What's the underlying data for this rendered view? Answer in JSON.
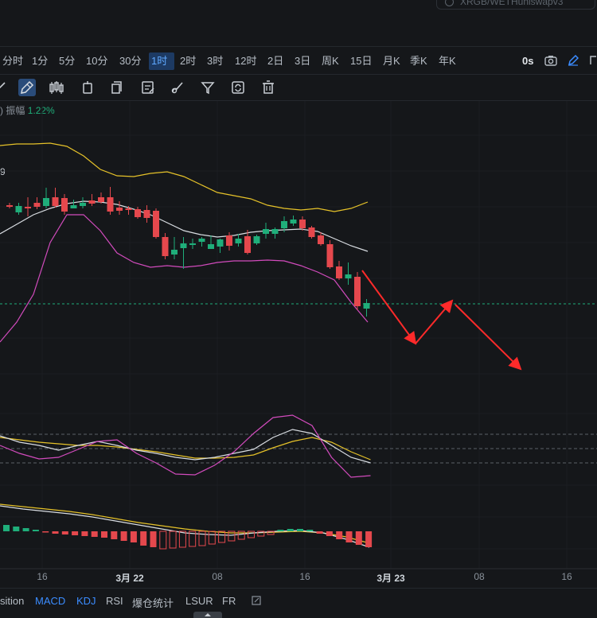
{
  "search": {
    "placeholder": "XRGB/WETHuniswapv3"
  },
  "timeframes": [
    "分时",
    "1分",
    "5分",
    "10分",
    "30分",
    "1时",
    "2时",
    "3时",
    "12时",
    "2日",
    "3日",
    "周K",
    "15日",
    "月K",
    "季K",
    "年K"
  ],
  "active_timeframe": "1时",
  "countdown": "0s",
  "tools": [
    "cursor-icon",
    "pencil-line-icon",
    "candlestick-icon",
    "indicator-icon",
    "copy-icon",
    "note-icon",
    "brush-icon",
    "filter-icon",
    "sync-icon",
    "trash-icon"
  ],
  "legend": {
    "prefix": ")",
    "label": "振幅",
    "value": "1.22%"
  },
  "ma_value": "9",
  "x_axis_labels": [
    "16",
    "3月 22",
    "08",
    "16",
    "3月 23",
    "08",
    "16"
  ],
  "indicator_tabs": [
    "sition",
    "MACD",
    "KDJ",
    "RSI",
    "爆仓统计",
    "LSUR",
    "FR"
  ],
  "active_indicators": [
    "MACD",
    "KDJ"
  ],
  "colors": {
    "background": "#15171a",
    "up": "#1fae7a",
    "down": "#e5484d",
    "boll_upper": "#e6c229",
    "boll_mid": "#d9dde2",
    "boll_lower": "#d24bbd",
    "arrow": "#ff2a2a",
    "accent": "#3b8cff"
  },
  "chart_data": {
    "type": "candlestick",
    "candles": [
      {
        "o": 258,
        "h": 255,
        "l": 262,
        "c": 260
      },
      {
        "o": 267,
        "h": 255,
        "l": 270,
        "c": 259
      },
      {
        "o": 260,
        "h": 248,
        "l": 272,
        "c": 262
      },
      {
        "o": 255,
        "h": 248,
        "l": 263,
        "c": 260
      },
      {
        "o": 259,
        "h": 236,
        "l": 262,
        "c": 249
      },
      {
        "o": 248,
        "h": 236,
        "l": 261,
        "c": 259
      },
      {
        "o": 249,
        "h": 244,
        "l": 270,
        "c": 266
      },
      {
        "o": 262,
        "h": 251,
        "l": 262,
        "c": 258
      },
      {
        "o": 259,
        "h": 248,
        "l": 262,
        "c": 255
      },
      {
        "o": 252,
        "h": 244,
        "l": 259,
        "c": 256
      },
      {
        "o": 248,
        "h": 242,
        "l": 256,
        "c": 254
      },
      {
        "o": 248,
        "h": 235,
        "l": 270,
        "c": 266
      },
      {
        "o": 261,
        "h": 253,
        "l": 270,
        "c": 265
      },
      {
        "o": 262,
        "h": 259,
        "l": 270,
        "c": 264
      },
      {
        "o": 263,
        "h": 260,
        "l": 275,
        "c": 273
      },
      {
        "o": 264,
        "h": 258,
        "l": 280,
        "c": 274
      },
      {
        "o": 265,
        "h": 262,
        "l": 300,
        "c": 298
      },
      {
        "o": 298,
        "h": 293,
        "l": 326,
        "c": 322
      },
      {
        "o": 320,
        "h": 298,
        "l": 326,
        "c": 314
      },
      {
        "o": 312,
        "h": 298,
        "l": 338,
        "c": 306
      },
      {
        "o": 308,
        "h": 300,
        "l": 313,
        "c": 306
      },
      {
        "o": 304,
        "h": 298,
        "l": 310,
        "c": 300
      },
      {
        "o": 313,
        "h": 296,
        "l": 313,
        "c": 307
      },
      {
        "o": 310,
        "h": 300,
        "l": 318,
        "c": 301
      },
      {
        "o": 296,
        "h": 292,
        "l": 315,
        "c": 309
      },
      {
        "o": 306,
        "h": 294,
        "l": 310,
        "c": 300
      },
      {
        "o": 297,
        "h": 289,
        "l": 320,
        "c": 318
      },
      {
        "o": 306,
        "h": 295,
        "l": 308,
        "c": 297
      },
      {
        "o": 294,
        "h": 280,
        "l": 300,
        "c": 288
      },
      {
        "o": 294,
        "h": 286,
        "l": 300,
        "c": 288
      },
      {
        "o": 287,
        "h": 272,
        "l": 292,
        "c": 278
      },
      {
        "o": 281,
        "h": 271,
        "l": 284,
        "c": 276
      },
      {
        "o": 276,
        "h": 272,
        "l": 290,
        "c": 287
      },
      {
        "o": 286,
        "h": 284,
        "l": 300,
        "c": 298
      },
      {
        "o": 296,
        "h": 292,
        "l": 309,
        "c": 307
      },
      {
        "o": 307,
        "h": 302,
        "l": 338,
        "c": 336
      },
      {
        "o": 335,
        "h": 328,
        "l": 352,
        "c": 350
      },
      {
        "o": 350,
        "h": 330,
        "l": 358,
        "c": 345
      },
      {
        "o": 348,
        "h": 342,
        "l": 390,
        "c": 385
      },
      {
        "o": 388,
        "h": 376,
        "l": 398,
        "c": 381
      }
    ],
    "bollinger": {
      "upper": [
        183,
        181,
        181,
        180,
        184,
        196,
        213,
        221,
        222,
        218,
        216,
        222,
        232,
        242,
        246,
        250,
        258,
        262,
        264,
        262,
        266,
        262,
        254
      ],
      "mid": [
        294,
        282,
        270,
        262,
        256,
        253,
        254,
        257,
        263,
        270,
        280,
        290,
        295,
        298,
        296,
        292,
        290,
        289,
        288,
        291,
        300,
        309,
        316
      ],
      "lower": [
        430,
        405,
        370,
        305,
        270,
        270,
        290,
        318,
        330,
        336,
        334,
        336,
        334,
        330,
        328,
        328,
        327,
        328,
        334,
        342,
        352,
        380,
        405
      ]
    },
    "prediction_arrows": [
      {
        "from": [
          455,
          340
        ],
        "to": [
          522,
          432
        ]
      },
      {
        "from": [
          522,
          432
        ],
        "to": [
          568,
          378
        ]
      },
      {
        "from": [
          572,
          383
        ],
        "to": [
          654,
          464
        ]
      }
    ]
  }
}
